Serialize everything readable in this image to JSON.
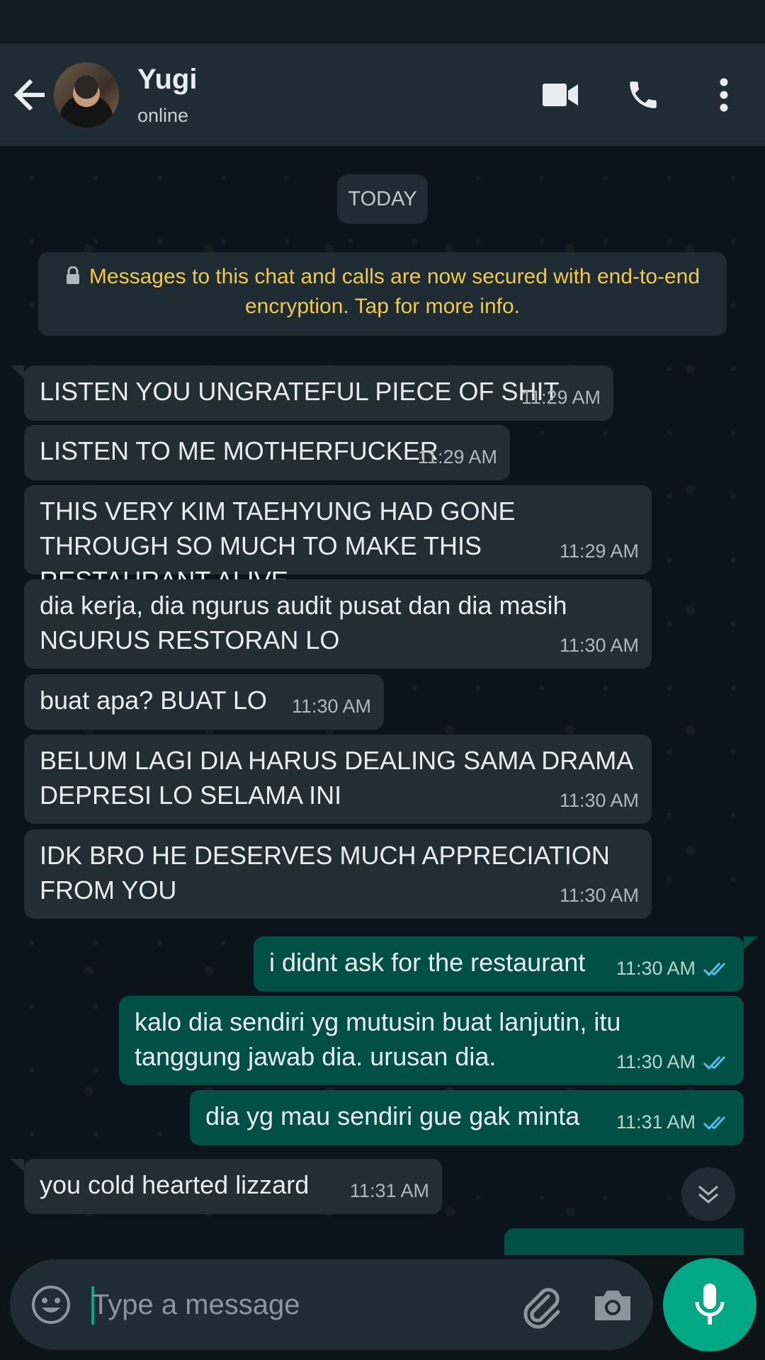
{
  "header": {
    "contact_name": "Yugi",
    "contact_status": "online",
    "icons": [
      "back-arrow-icon",
      "video-call-icon",
      "voice-call-icon",
      "more-options-icon"
    ]
  },
  "chat": {
    "date_label": "TODAY",
    "encryption_notice": "Messages to this chat and calls are now secured with end-to-end encryption. Tap for more info.",
    "messages": [
      {
        "direction": "in",
        "text": "LISTEN YOU UNGRATEFUL PIECE OF SHIT",
        "time": "11:29 AM"
      },
      {
        "direction": "in",
        "text": "LISTEN TO ME MOTHERFUCKER",
        "time": "11:29 AM"
      },
      {
        "direction": "in",
        "text": "THIS VERY KIM TAEHYUNG HAD GONE THROUGH SO MUCH TO MAKE THIS RESTAURANT ALIVE",
        "time": "11:29 AM"
      },
      {
        "direction": "in",
        "text": "dia kerja, dia ngurus audit pusat dan dia masih NGURUS RESTORAN LO",
        "time": "11:30 AM"
      },
      {
        "direction": "in",
        "text": "buat apa? BUAT LO",
        "time": "11:30 AM"
      },
      {
        "direction": "in",
        "text": "BELUM LAGI DIA HARUS DEALING SAMA DRAMA DEPRESI LO SELAMA INI",
        "time": "11:30 AM"
      },
      {
        "direction": "in",
        "text": "IDK BRO HE DESERVES MUCH APPRECIATION FROM YOU",
        "time": "11:30 AM"
      },
      {
        "direction": "out",
        "text": "i didnt ask for the restaurant",
        "time": "11:30 AM",
        "status": "read"
      },
      {
        "direction": "out",
        "text": "kalo dia sendiri yg mutusin buat lanjutin, itu tanggung jawab dia. urusan dia.",
        "time": "11:30 AM",
        "status": "read"
      },
      {
        "direction": "out",
        "text": "dia yg mau sendiri gue gak minta",
        "time": "11:31 AM",
        "status": "read"
      },
      {
        "direction": "in",
        "text": "you cold hearted lizzard",
        "time": "11:31 AM"
      }
    ]
  },
  "composer": {
    "placeholder": "Type a message",
    "icons": [
      "emoji-icon",
      "attach-icon",
      "camera-icon",
      "mic-icon"
    ]
  },
  "colors": {
    "incoming_bubble": "#222d34",
    "outgoing_bubble": "#005046",
    "accent": "#00a884",
    "read_ticks": "#53bdeb",
    "encryption_text": "#f0c94b"
  }
}
